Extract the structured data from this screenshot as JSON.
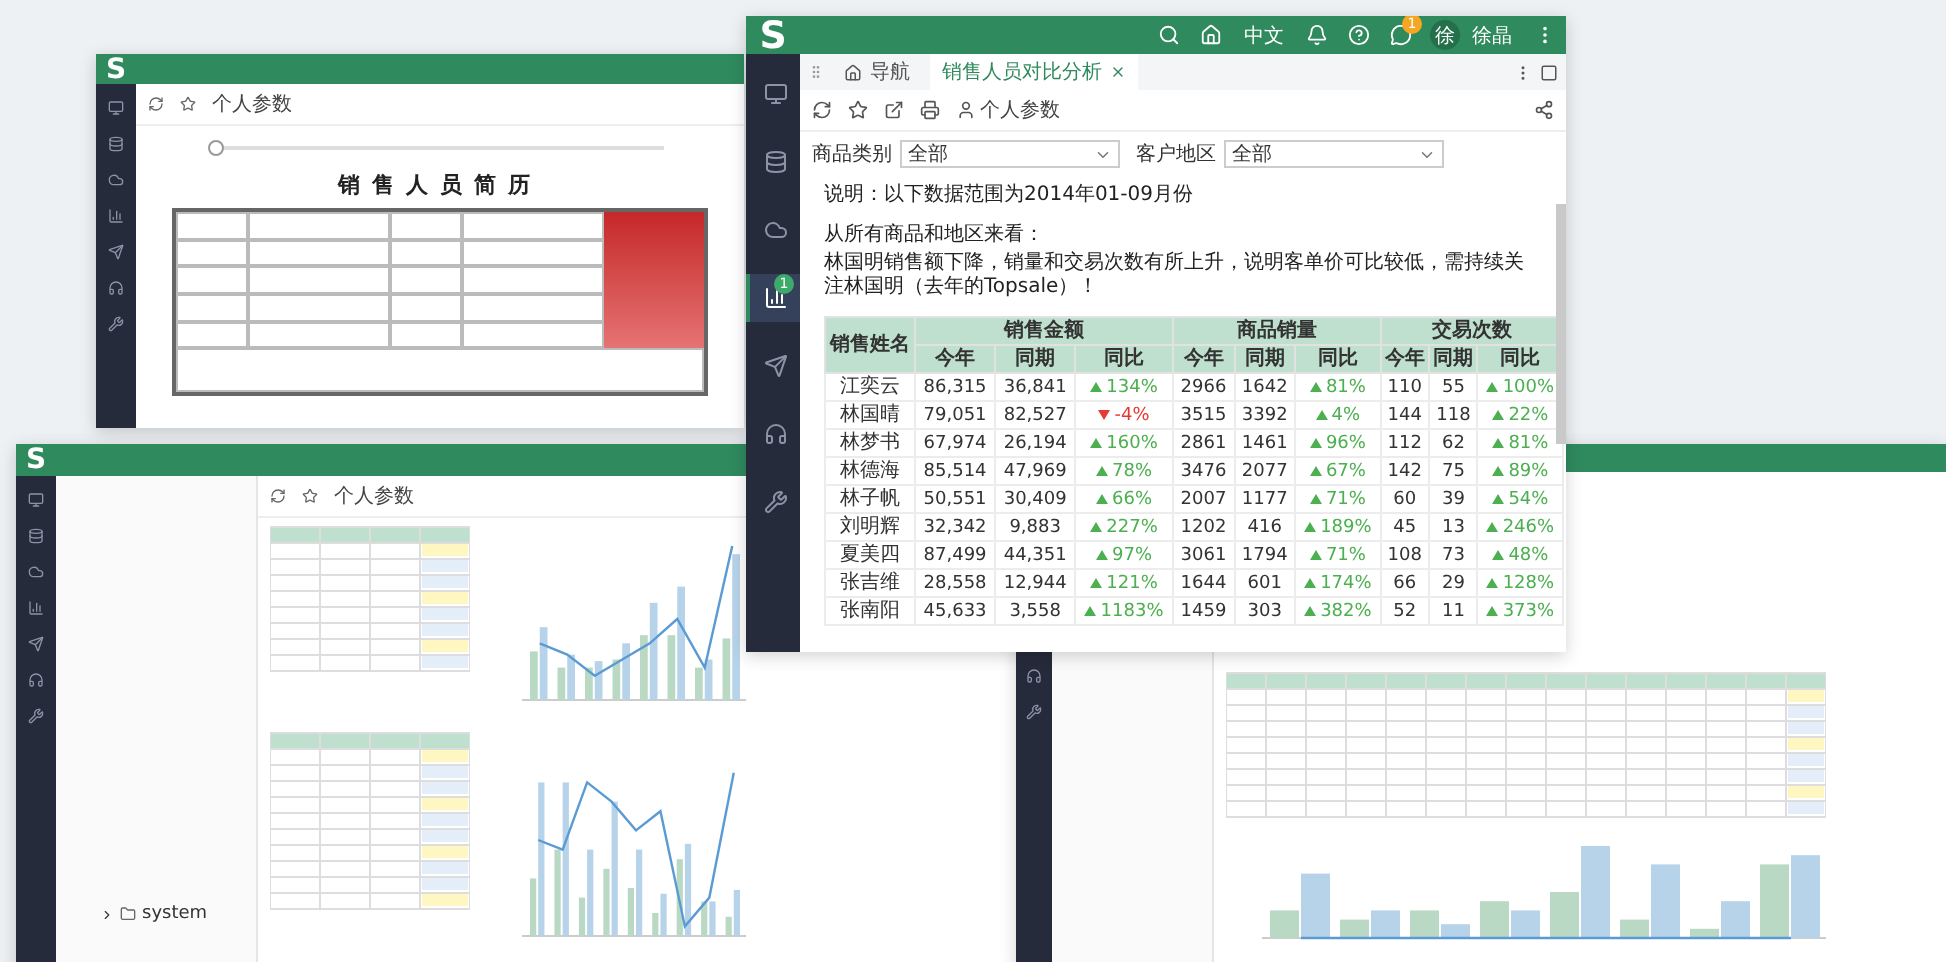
{
  "resume_window": {
    "logo": "S",
    "toolbar_label": "个人参数",
    "timeline": {
      "level": 0
    },
    "title": "销售人员简历"
  },
  "tree_window": {
    "logo": "S",
    "toolbar_label": "个人参数",
    "tree": [
      {
        "label": "system",
        "expanded": false
      }
    ]
  },
  "main_window": {
    "logo": "S",
    "header": {
      "language": "中文",
      "notification_count": "1",
      "avatar": "徐",
      "user": "徐晶"
    },
    "sidebar": {
      "badge": "1",
      "items": [
        {
          "kind": "monitor",
          "selected": false
        },
        {
          "kind": "database",
          "selected": false
        },
        {
          "kind": "cloud",
          "selected": false
        },
        {
          "kind": "chart",
          "selected": true
        },
        {
          "kind": "send",
          "selected": false
        },
        {
          "kind": "headset",
          "selected": false
        },
        {
          "kind": "tools",
          "selected": false
        }
      ]
    },
    "tabs": [
      {
        "label": "导航",
        "selected": false,
        "closable": false
      },
      {
        "label": "销售人员对比分析",
        "selected": true,
        "closable": true
      }
    ],
    "toolbar": {
      "params_label": "个人参数"
    },
    "filters": [
      {
        "label": "商品类别",
        "value": "全部"
      },
      {
        "label": "客户地区",
        "value": "全部"
      }
    ],
    "notes": [
      "说明：以下数据范围为2014年01-09月份",
      "从所有商品和地区来看：",
      "林国明销售额下降，销量和交易次数有所上升，说明客单价可比较低，需持续关注林国明（去年的Topsale）！"
    ],
    "table": {
      "name_header": "销售姓名",
      "groups": [
        {
          "title": "销售金额",
          "columns": [
            "今年",
            "同期",
            "同比"
          ]
        },
        {
          "title": "商品销量",
          "columns": [
            "今年",
            "同期",
            "同比"
          ]
        },
        {
          "title": "交易次数",
          "columns": [
            "今年",
            "同期",
            "同比"
          ]
        }
      ],
      "rows": [
        {
          "name": "江奕云",
          "cells": [
            {
              "text": "86,315"
            },
            {
              "text": "36,841"
            },
            {
              "text": "134%",
              "up": true
            },
            {
              "text": "2966"
            },
            {
              "text": "1642"
            },
            {
              "text": "81%",
              "up": true
            },
            {
              "text": "110"
            },
            {
              "text": "55"
            },
            {
              "text": "100%",
              "up": true
            }
          ]
        },
        {
          "name": "林国晴",
          "cells": [
            {
              "text": "79,051"
            },
            {
              "text": "82,527"
            },
            {
              "text": "-4%",
              "up": false
            },
            {
              "text": "3515"
            },
            {
              "text": "3392"
            },
            {
              "text": "4%",
              "up": true
            },
            {
              "text": "144"
            },
            {
              "text": "118"
            },
            {
              "text": "22%",
              "up": true
            }
          ]
        },
        {
          "name": "林梦书",
          "cells": [
            {
              "text": "67,974"
            },
            {
              "text": "26,194"
            },
            {
              "text": "160%",
              "up": true
            },
            {
              "text": "2861"
            },
            {
              "text": "1461"
            },
            {
              "text": "96%",
              "up": true
            },
            {
              "text": "112"
            },
            {
              "text": "62"
            },
            {
              "text": "81%",
              "up": true
            }
          ]
        },
        {
          "name": "林德海",
          "cells": [
            {
              "text": "85,514"
            },
            {
              "text": "47,969"
            },
            {
              "text": "78%",
              "up": true
            },
            {
              "text": "3476"
            },
            {
              "text": "2077"
            },
            {
              "text": "67%",
              "up": true
            },
            {
              "text": "142"
            },
            {
              "text": "75"
            },
            {
              "text": "89%",
              "up": true
            }
          ]
        },
        {
          "name": "林子帆",
          "cells": [
            {
              "text": "50,551"
            },
            {
              "text": "30,409"
            },
            {
              "text": "66%",
              "up": true
            },
            {
              "text": "2007"
            },
            {
              "text": "1177"
            },
            {
              "text": "71%",
              "up": true
            },
            {
              "text": "60"
            },
            {
              "text": "39"
            },
            {
              "text": "54%",
              "up": true
            }
          ]
        },
        {
          "name": "刘明辉",
          "cells": [
            {
              "text": "32,342"
            },
            {
              "text": "9,883"
            },
            {
              "text": "227%",
              "up": true
            },
            {
              "text": "1202"
            },
            {
              "text": "416"
            },
            {
              "text": "189%",
              "up": true
            },
            {
              "text": "45"
            },
            {
              "text": "13"
            },
            {
              "text": "246%",
              "up": true
            }
          ]
        },
        {
          "name": "夏美四",
          "cells": [
            {
              "text": "87,499"
            },
            {
              "text": "44,351"
            },
            {
              "text": "97%",
              "up": true
            },
            {
              "text": "3061"
            },
            {
              "text": "1794"
            },
            {
              "text": "71%",
              "up": true
            },
            {
              "text": "108"
            },
            {
              "text": "73"
            },
            {
              "text": "48%",
              "up": true
            }
          ]
        },
        {
          "name": "张吉维",
          "cells": [
            {
              "text": "28,558"
            },
            {
              "text": "12,944"
            },
            {
              "text": "121%",
              "up": true
            },
            {
              "text": "1644"
            },
            {
              "text": "601"
            },
            {
              "text": "174%",
              "up": true
            },
            {
              "text": "66"
            },
            {
              "text": "29"
            },
            {
              "text": "128%",
              "up": true
            }
          ]
        },
        {
          "name": "张南阳",
          "cells": [
            {
              "text": "45,633"
            },
            {
              "text": "3,558"
            },
            {
              "text": "1183%",
              "up": true
            },
            {
              "text": "1459"
            },
            {
              "text": "303"
            },
            {
              "text": "382%",
              "up": true
            },
            {
              "text": "52"
            },
            {
              "text": "11"
            },
            {
              "text": "373%",
              "up": true
            }
          ]
        }
      ]
    }
  }
}
